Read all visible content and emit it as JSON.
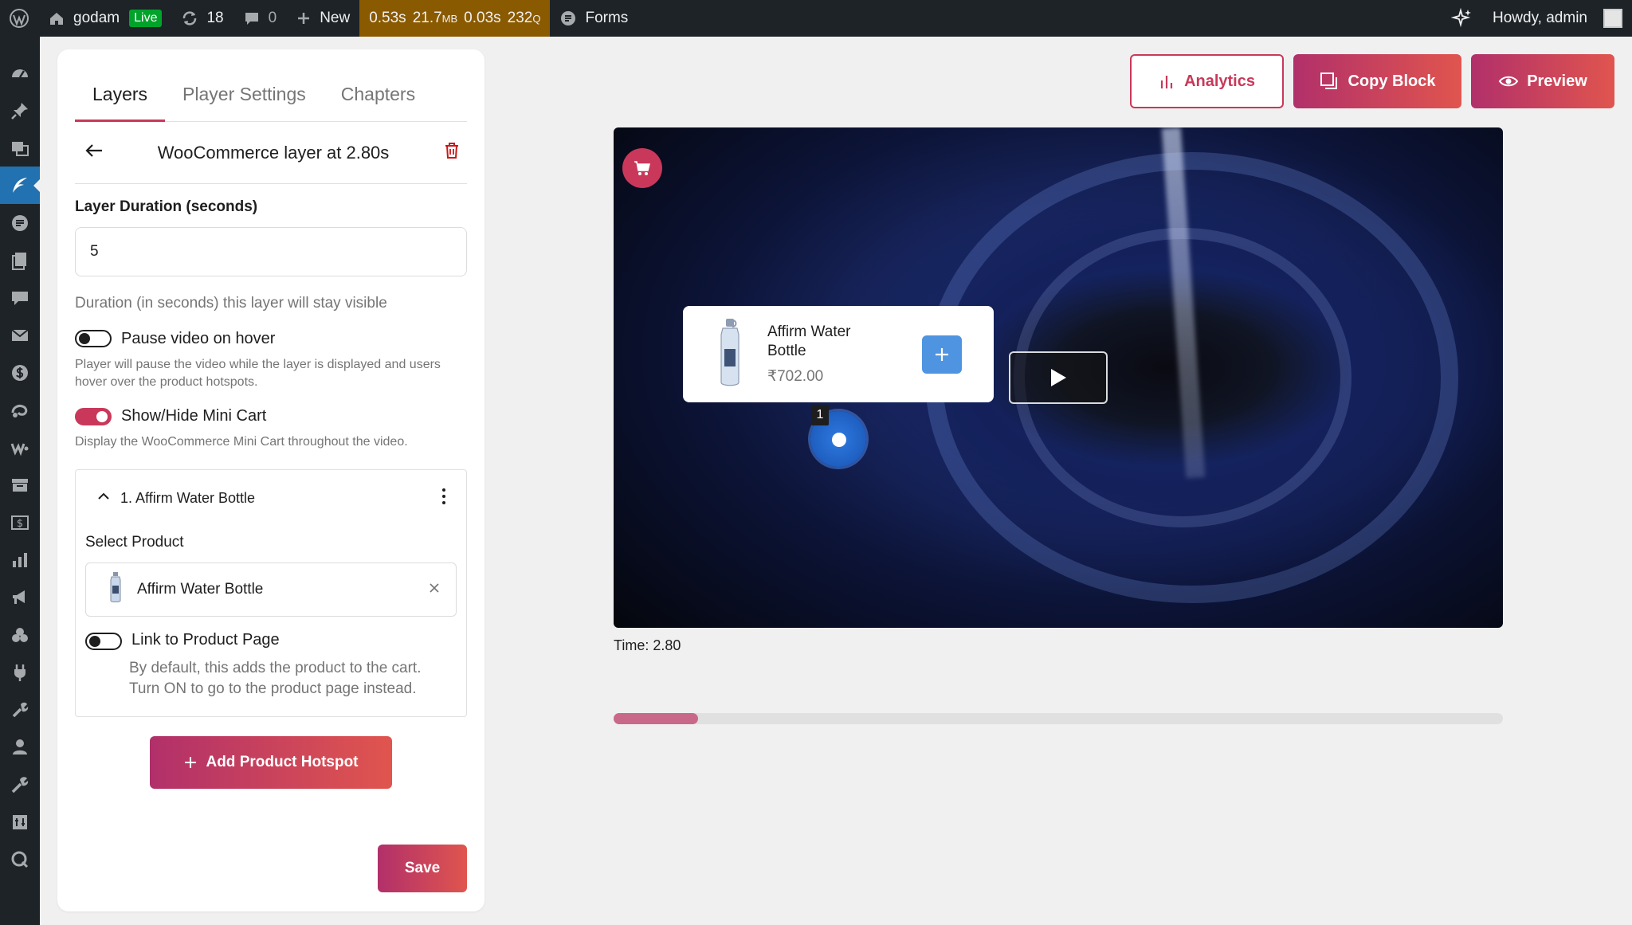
{
  "adminbar": {
    "site_name": "godam",
    "live_badge": "Live",
    "updates_count": "18",
    "comments_count": "0",
    "new_label": "New",
    "perf": {
      "time1": "0.53s",
      "mem": "21.7",
      "mem_unit": "MB",
      "time2": "0.03s",
      "queries": "232",
      "queries_unit": "Q"
    },
    "forms_label": "Forms",
    "howdy": "Howdy, admin"
  },
  "sidemenu": {
    "icons": [
      "gauge-icon",
      "pin-icon",
      "media-icon",
      "feather-icon",
      "godam-icon",
      "pages-icon",
      "comments-icon",
      "mail-icon",
      "dollar-icon",
      "plugin-stack-icon",
      "woo-icon",
      "archive-icon",
      "payments-icon",
      "analytics-icon",
      "marketing-icon",
      "appearance-icon",
      "plugins-icon",
      "tools-icon",
      "users-icon",
      "wrench-icon",
      "settings-icon",
      "query-icon"
    ],
    "active_index": 3
  },
  "panel": {
    "tabs": [
      {
        "label": "Layers",
        "active": true
      },
      {
        "label": "Player Settings",
        "active": false
      },
      {
        "label": "Chapters",
        "active": false
      }
    ],
    "layer_title": "WooCommerce layer at 2.80s",
    "duration_label": "Layer Duration (seconds)",
    "duration_value": "5",
    "duration_help": "Duration (in seconds) this layer will stay visible",
    "pause_label": "Pause video on hover",
    "pause_on": false,
    "pause_help": "Player will pause the video while the layer is displayed and users hover over the product hotspots.",
    "minicart_label": "Show/Hide Mini Cart",
    "minicart_on": true,
    "minicart_help": "Display the WooCommerce Mini Cart throughout the video.",
    "hotspot": {
      "title": "1. Affirm Water Bottle",
      "select_label": "Select Product",
      "product_name": "Affirm Water Bottle",
      "link_label": "Link to Product Page",
      "link_on": false,
      "link_help_1": "By default, this adds the product to the cart.",
      "link_help_2": "Turn ON to go to the product page instead."
    },
    "add_hotspot_label": "Add Product Hotspot",
    "save_label": "Save"
  },
  "toolbar": {
    "analytics_label": "Analytics",
    "copy_label": "Copy Block",
    "preview_label": "Preview"
  },
  "video": {
    "popup_name_1": "Affirm Water",
    "popup_name_2": "Bottle",
    "popup_price": "₹702.00",
    "hotspot_number": "1",
    "time_label": "Time: 2.80",
    "progress": 0.095
  },
  "colors": {
    "accent": "#c9385a",
    "admin_bar": "#1d2327",
    "active_menu": "#2271b1",
    "add_button": "#4f94e0"
  }
}
